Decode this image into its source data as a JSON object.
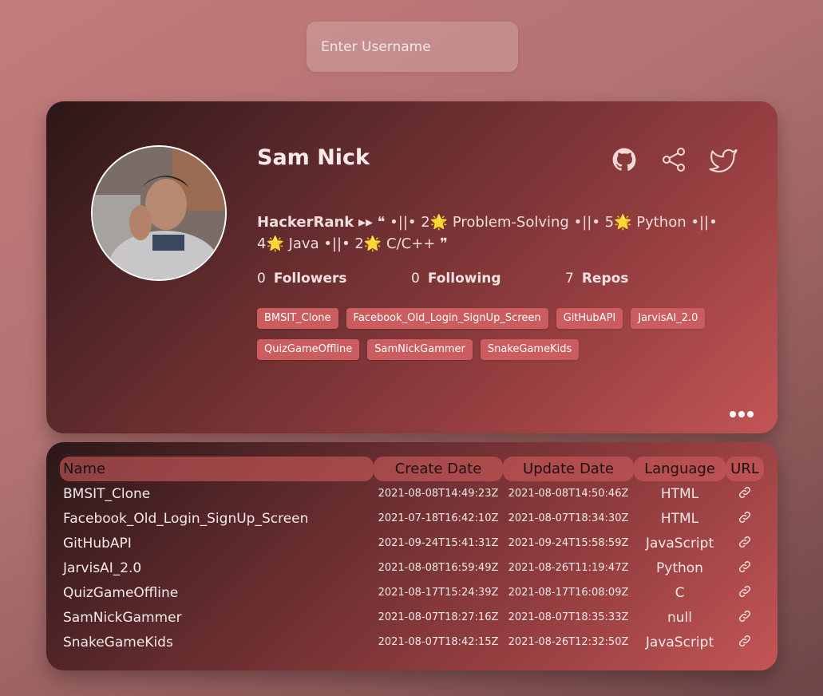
{
  "search": {
    "placeholder": "Enter Username",
    "value": ""
  },
  "profile": {
    "name": "Sam Nick",
    "bio_brand": "HackerRank",
    "bio_rest": " ▸▸ ❝ •||• 2🌟 Problem-Solving •||• 5🌟 Python •||• 4🌟 Java •||• 2🌟 C/C++ ❞",
    "social_icons": [
      "github-icon",
      "share-icon",
      "twitter-icon"
    ],
    "stats": {
      "followers_count": "0",
      "followers_label": "Followers",
      "following_count": "0",
      "following_label": "Following",
      "repos_count": "7",
      "repos_label": "Repos"
    },
    "repo_tags": [
      "BMSIT_Clone",
      "Facebook_Old_Login_SignUp_Screen",
      "GitHubAPI",
      "JarvisAI_2.0",
      "QuizGameOffline",
      "SamNickGammer",
      "SnakeGameKids"
    ],
    "more_icon": "more-dots-icon"
  },
  "repo_table": {
    "headers": {
      "name": "Name",
      "create_date": "Create Date",
      "update_date": "Update Date",
      "language": "Language",
      "url": "URL"
    },
    "link_icon": "link-icon",
    "rows": [
      {
        "name": "BMSIT_Clone",
        "create_date": "2021-08-08T14:49:23Z",
        "update_date": "2021-08-08T14:50:46Z",
        "language": "HTML"
      },
      {
        "name": "Facebook_Old_Login_SignUp_Screen",
        "create_date": "2021-07-18T16:42:10Z",
        "update_date": "2021-08-07T18:34:30Z",
        "language": "HTML"
      },
      {
        "name": "GitHubAPI",
        "create_date": "2021-09-24T15:41:31Z",
        "update_date": "2021-09-24T15:58:59Z",
        "language": "JavaScript"
      },
      {
        "name": "JarvisAI_2.0",
        "create_date": "2021-08-08T16:59:49Z",
        "update_date": "2021-08-26T11:19:47Z",
        "language": "Python"
      },
      {
        "name": "QuizGameOffline",
        "create_date": "2021-08-17T15:24:39Z",
        "update_date": "2021-08-17T16:08:09Z",
        "language": "C"
      },
      {
        "name": "SamNickGammer",
        "create_date": "2021-08-07T18:27:16Z",
        "update_date": "2021-08-07T18:35:33Z",
        "language": "null"
      },
      {
        "name": "SnakeGameKids",
        "create_date": "2021-08-07T18:42:15Z",
        "update_date": "2021-08-26T12:32:50Z",
        "language": "JavaScript"
      }
    ]
  },
  "colors": {
    "tag_background": "#cb5c5f",
    "card_gradient_start": "#2c1718",
    "card_gradient_end": "#c35555"
  }
}
